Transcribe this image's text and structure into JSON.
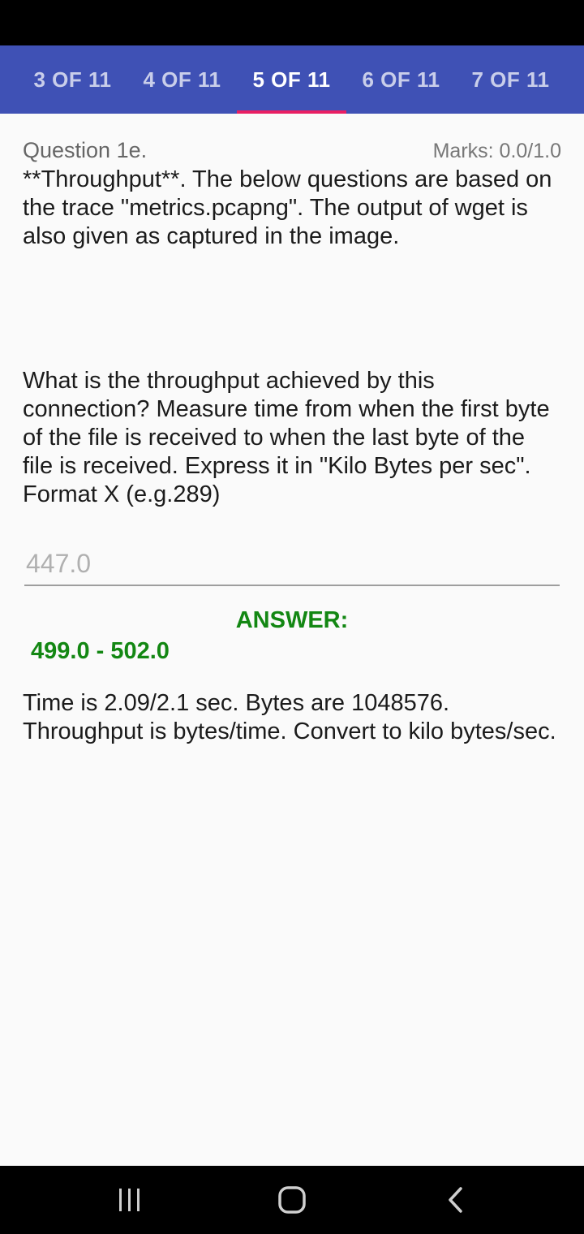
{
  "tabs": [
    {
      "label": "3 OF 11"
    },
    {
      "label": "4 OF 11"
    },
    {
      "label": "5 OF 11"
    },
    {
      "label": "6 OF 11"
    },
    {
      "label": "7 OF 11"
    }
  ],
  "active_tab": "5 OF 11",
  "question": {
    "label": "Question 1e.",
    "marks": "Marks: 0.0/1.0",
    "intro": "**Throughput**. The below questions are based on the trace \"metrics.pcapng\". The output of wget is also given as captured in the image.",
    "text": "What is the throughput achieved by this connection? Measure time from when the first byte of the file is received to when the last byte of the file is received. Express it in \"Kilo Bytes per sec\". Format X (e.g.289)"
  },
  "answer_input": {
    "placeholder": "447.0"
  },
  "answer": {
    "heading": "ANSWER:",
    "range": "499.0 - 502.0",
    "explanation": "Time is 2.09/2.1 sec. Bytes are 1048576. Throughput is bytes/time. Convert to kilo bytes/sec."
  },
  "colors": {
    "tab_bar": "#3f51b5",
    "tab_indicator": "#e91e63",
    "answer_green": "#138713"
  },
  "nav": {
    "icons": [
      "recent-apps-icon",
      "home-icon",
      "back-icon"
    ]
  }
}
